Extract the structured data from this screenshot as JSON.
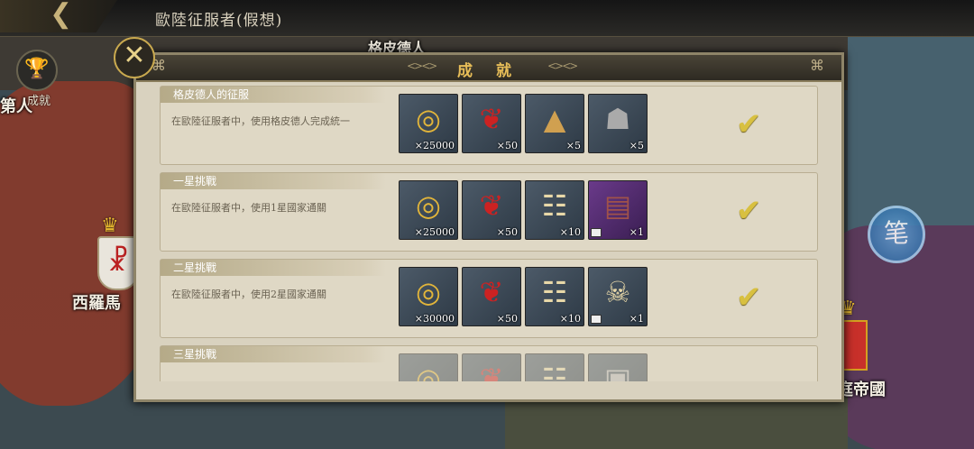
{
  "header": {
    "back_icon": "back-arrow-icon",
    "title": "歐陸征服者(假想)"
  },
  "map_labels": {
    "top": "格皮德人",
    "left_top": "第人",
    "left": "西羅馬",
    "right": "庭帝國"
  },
  "side_button": {
    "label": "成就",
    "icon": "trophy-icon"
  },
  "dialog": {
    "title": "成 就",
    "close_icon": "close-icon",
    "rows": [
      {
        "title": "格皮德人的征服",
        "desc": "在歐陸征服者中，使用格皮德人完成統一",
        "completed": true,
        "items": [
          {
            "icon": "gold-coins-icon",
            "qty": "×25000"
          },
          {
            "icon": "emblem-medal-icon",
            "qty": "×50"
          },
          {
            "icon": "war-horn-icon",
            "qty": "×5"
          },
          {
            "icon": "armor-icon",
            "qty": "×5"
          }
        ]
      },
      {
        "title": "一星挑戰",
        "desc": "在歐陸征服者中，使用1星國家通關",
        "completed": true,
        "items": [
          {
            "icon": "gold-coins-icon",
            "qty": "×25000"
          },
          {
            "icon": "emblem-medal-icon",
            "qty": "×50"
          },
          {
            "icon": "scroll-icon",
            "qty": "×10"
          },
          {
            "icon": "spell-book-icon",
            "qty": "×1"
          }
        ]
      },
      {
        "title": "二星挑戰",
        "desc": "在歐陸征服者中，使用2星國家通關",
        "completed": true,
        "items": [
          {
            "icon": "gold-coins-icon",
            "qty": "×30000"
          },
          {
            "icon": "emblem-medal-icon",
            "qty": "×50"
          },
          {
            "icon": "scroll-icon",
            "qty": "×10"
          },
          {
            "icon": "pirate-map-icon",
            "qty": "×1"
          }
        ]
      },
      {
        "title": "三星挑戰",
        "desc": "",
        "completed": false,
        "items": [
          {
            "icon": "gold-coins-icon",
            "qty": ""
          },
          {
            "icon": "emblem-medal-icon",
            "qty": ""
          },
          {
            "icon": "scroll-icon",
            "qty": ""
          },
          {
            "icon": "item-icon",
            "qty": ""
          }
        ]
      }
    ]
  },
  "floating_button": {
    "icon": "quill-icon",
    "color": "#3a78b0"
  },
  "colors": {
    "title_gold": "#e7bd58",
    "check": "#d8c040",
    "panel": "#d9d2bf"
  }
}
